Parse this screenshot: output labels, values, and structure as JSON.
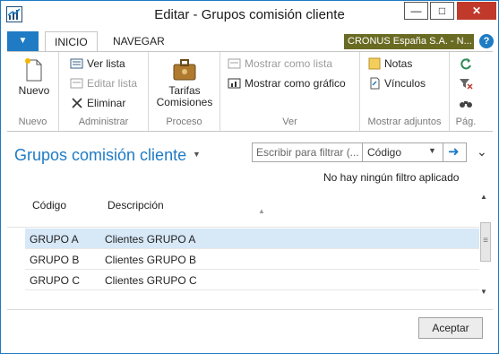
{
  "window": {
    "title": "Editar - Grupos comisión cliente"
  },
  "ribbon": {
    "tabs": [
      {
        "label": "INICIO"
      },
      {
        "label": "NAVEGAR"
      }
    ],
    "company": "CRONUS España S.A. - N...",
    "help": "?",
    "groups": {
      "nuevo": {
        "label": "Nuevo",
        "buttons": {
          "nuevo": "Nuevo"
        }
      },
      "administrar": {
        "label": "Administrar",
        "buttons": {
          "ver_lista": "Ver lista",
          "editar_lista": "Editar lista",
          "eliminar": "Eliminar"
        }
      },
      "proceso": {
        "label": "Proceso",
        "buttons": {
          "tarifas": "Tarifas",
          "comisiones": "Comisiones"
        }
      },
      "ver": {
        "label": "Ver",
        "buttons": {
          "mostrar_lista": "Mostrar como lista",
          "mostrar_grafico": "Mostrar como gráfico"
        }
      },
      "adjuntos": {
        "label": "Mostrar adjuntos",
        "buttons": {
          "notas": "Notas",
          "vinculos": "Vínculos"
        }
      },
      "pag": {
        "label": "Pág."
      }
    }
  },
  "page": {
    "title": "Grupos comisión cliente",
    "filter": {
      "placeholder": "Escribir para filtrar (...",
      "field": "Código"
    },
    "no_filter": "No hay ningún filtro aplicado"
  },
  "grid": {
    "columns": [
      "Código",
      "Descripción"
    ],
    "rows": [
      {
        "codigo": "GRUPO A",
        "descripcion": "Clientes GRUPO A"
      },
      {
        "codigo": "GRUPO B",
        "descripcion": "Clientes GRUPO B"
      },
      {
        "codigo": "GRUPO C",
        "descripcion": "Clientes GRUPO C"
      }
    ]
  },
  "footer": {
    "ok": "Aceptar"
  },
  "colors": {
    "accent": "#1e7bc4",
    "company_bg": "#6a6b23",
    "selected_row": "#d7e8f7"
  }
}
